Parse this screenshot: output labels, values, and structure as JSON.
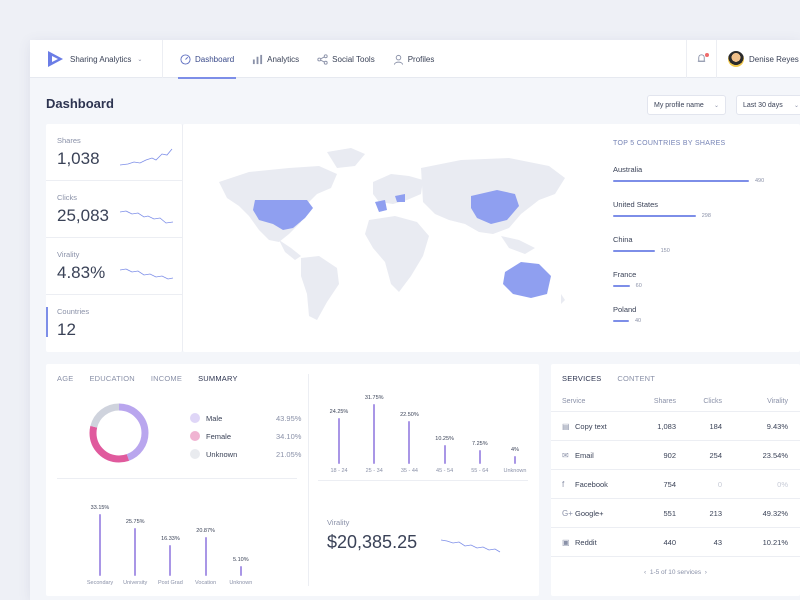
{
  "brand": {
    "name": "Sharing Analytics"
  },
  "nav": [
    {
      "label": "Dashboard",
      "icon": "gauge-icon",
      "active": true
    },
    {
      "label": "Analytics",
      "icon": "bar-chart-icon",
      "active": false
    },
    {
      "label": "Social Tools",
      "icon": "share-icon",
      "active": false
    },
    {
      "label": "Profiles",
      "icon": "user-icon",
      "active": false
    }
  ],
  "user": {
    "name": "Denise Reyes"
  },
  "page": {
    "title": "Dashboard"
  },
  "filters": {
    "profile": "My profile name",
    "range": "Last 30 days"
  },
  "stats": [
    {
      "label": "Shares",
      "value": "1,038"
    },
    {
      "label": "Clicks",
      "value": "25,083"
    },
    {
      "label": "Virality",
      "value": "4.83%"
    },
    {
      "label": "Countries",
      "value": "12"
    }
  ],
  "top_countries": {
    "title": "TOP 5 COUNTRIES BY SHARES",
    "items": [
      {
        "name": "Australia",
        "value": 490
      },
      {
        "name": "United States",
        "value": 298
      },
      {
        "name": "China",
        "value": 150
      },
      {
        "name": "France",
        "value": 60
      },
      {
        "name": "Poland",
        "value": 40
      }
    ]
  },
  "demo_tabs": [
    "AGE",
    "EDUCATION",
    "INCOME",
    "SUMMARY"
  ],
  "gender": [
    {
      "label": "Male",
      "pct": "43.95%",
      "value": 43.95,
      "color": "#b9a6ee"
    },
    {
      "label": "Female",
      "pct": "34.10%",
      "value": 34.1,
      "color": "#e05a9d"
    },
    {
      "label": "Unknown",
      "pct": "21.05%",
      "value": 21.05,
      "color": "#cfd3dd"
    }
  ],
  "chart_data": [
    {
      "type": "bar",
      "categories": [
        "18 - 24",
        "25 - 34",
        "35 - 44",
        "45 - 54",
        "55 - 64",
        "Unknown"
      ],
      "values": [
        24.25,
        31.75,
        22.5,
        10.25,
        7.25,
        4
      ],
      "labels": [
        "24.25%",
        "31.75%",
        "22.50%",
        "10.25%",
        "7.25%",
        "4%"
      ]
    },
    {
      "type": "bar",
      "categories": [
        "Secondary",
        "University",
        "Post Grad",
        "Vocation",
        "Unknown"
      ],
      "values": [
        33.15,
        25.75,
        16.33,
        20.87,
        5.1
      ],
      "labels": [
        "33.15%",
        "25.75%",
        "16.33%",
        "20.87%",
        "5.10%"
      ]
    }
  ],
  "virality": {
    "label": "Virality",
    "value": "$20,385.25"
  },
  "services": {
    "tabs": [
      "SERVICES",
      "CONTENT"
    ],
    "headers": {
      "service": "Service",
      "shares": "Shares",
      "clicks": "Clicks",
      "virality": "Virality"
    },
    "rows": [
      {
        "icon": "document-icon",
        "glyph": "▤",
        "service": "Copy text",
        "shares": "1,083",
        "clicks": "184",
        "virality": "9.43%",
        "muted": false
      },
      {
        "icon": "mail-icon",
        "glyph": "✉",
        "service": "Email",
        "shares": "902",
        "clicks": "254",
        "virality": "23.54%",
        "muted": false
      },
      {
        "icon": "facebook-icon",
        "glyph": "f",
        "service": "Facebook",
        "shares": "754",
        "clicks": "0",
        "virality": "0%",
        "muted": true
      },
      {
        "icon": "google-plus-icon",
        "glyph": "G+",
        "service": "Google+",
        "shares": "551",
        "clicks": "213",
        "virality": "49.32%",
        "muted": false
      },
      {
        "icon": "reddit-icon",
        "glyph": "▣",
        "service": "Reddit",
        "shares": "440",
        "clicks": "43",
        "virality": "10.21%",
        "muted": false
      }
    ],
    "pager": "1-5 of 10 services"
  }
}
